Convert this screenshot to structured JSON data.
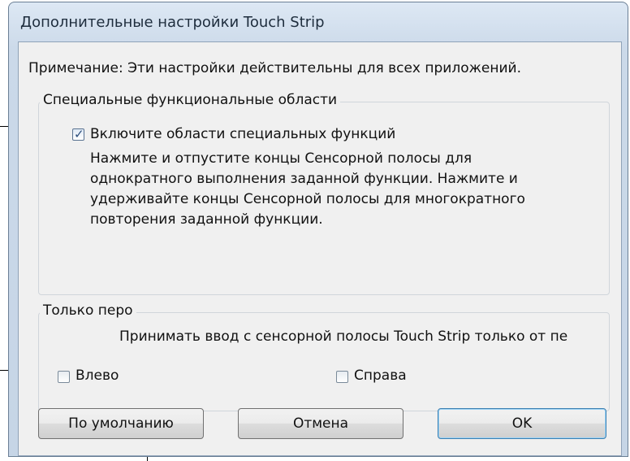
{
  "window": {
    "title": "Дополнительные настройки Touch Strip"
  },
  "note": "Примечание: Эти настройки действительны для всех приложений.",
  "special_functions": {
    "legend": "Специальные функциональные области",
    "enable_checkbox": {
      "label": "Включите области специальных функций",
      "checked": true
    },
    "description_lines": [
      "Нажмите и отпустите концы Сенсорной полосы для",
      "однократного выполнения заданной функции. Нажмите и",
      "удерживайте концы Сенсорной полосы для многократного",
      "повторения заданной функции."
    ]
  },
  "pen_only": {
    "legend": "Только перо",
    "text": "Принимать ввод с сенсорной полосы Touch Strip только от пе",
    "left_checkbox": {
      "label": "Влево",
      "checked": false
    },
    "right_checkbox": {
      "label": "Справа",
      "checked": false
    }
  },
  "buttons": {
    "default_label": "По умолчанию",
    "cancel_label": "Отмена",
    "ok_label": "OK"
  }
}
